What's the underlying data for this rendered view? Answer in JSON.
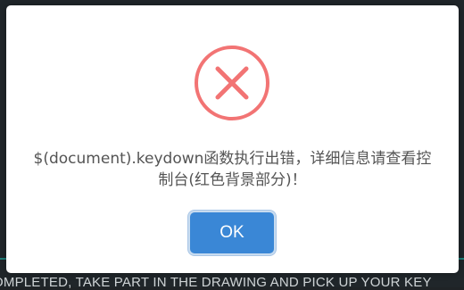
{
  "background": {
    "footer_text": "OMPLETED, TAKE PART IN THE DRAWING AND PICK UP YOUR KEY"
  },
  "dialog": {
    "icon": "error-x-icon",
    "message": "$(document).keydown函数执行出错，详细信息请查看控制台(红色背景部分)！",
    "ok_label": "OK"
  },
  "colors": {
    "error": "#f27474",
    "button": "#3a87d6",
    "text": "#545454"
  }
}
